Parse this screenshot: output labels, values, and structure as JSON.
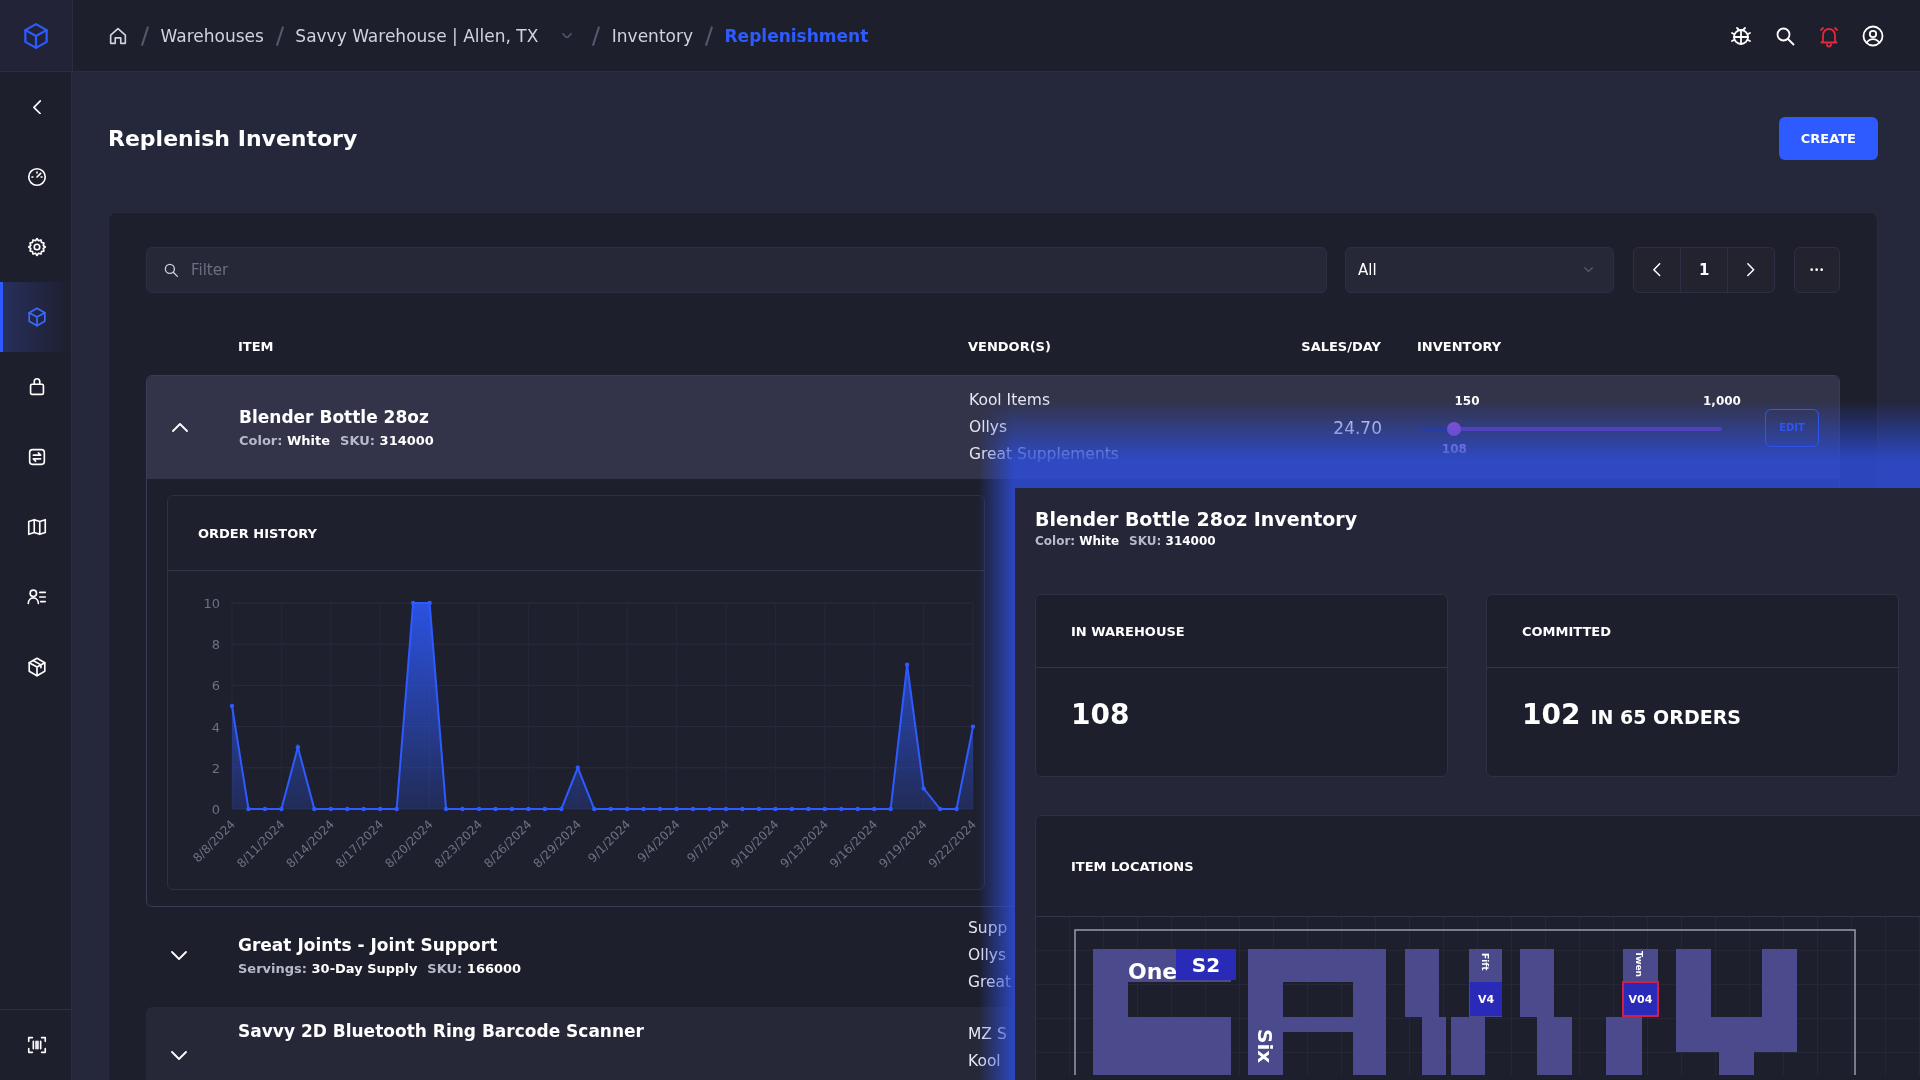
{
  "topbar": {
    "breadcrumbs": [
      {
        "label": "Warehouses",
        "kind": "link"
      },
      {
        "label": "Savvy Warehouse | Allen, TX",
        "kind": "dropdown"
      },
      {
        "label": "Inventory",
        "kind": "link"
      },
      {
        "label": "Replenishment",
        "kind": "current"
      }
    ],
    "alert": true
  },
  "sidebar": {
    "items": [
      {
        "kind": "gauge",
        "selected": false
      },
      {
        "kind": "gear",
        "selected": false
      },
      {
        "kind": "cube",
        "selected": true
      },
      {
        "kind": "bag",
        "selected": false
      },
      {
        "kind": "swap",
        "selected": false
      },
      {
        "kind": "map",
        "selected": false
      },
      {
        "kind": "user-list",
        "selected": false
      },
      {
        "kind": "package",
        "selected": false
      }
    ],
    "footer": [
      {
        "kind": "barcode",
        "selected": false
      }
    ]
  },
  "page": {
    "title": "Replenish Inventory",
    "create_button": "CREATE"
  },
  "toolbar": {
    "filter": {
      "placeholder": "Filter"
    },
    "select": {
      "value": "All"
    },
    "pager": {
      "page": "1"
    }
  },
  "table": {
    "columns": [
      "ITEM",
      "VENDOR(S)",
      "SALES/DAY",
      "INVENTORY"
    ],
    "rows": [
      {
        "name": "Blender Bottle 28oz",
        "meta": [
          "Color: **White**",
          "SKU: **314000**"
        ],
        "vendors": [
          "Kool Items",
          "Ollys",
          "Great Supplements"
        ],
        "sales_per_day": "24.70",
        "inventory": {
          "level": 0.108,
          "reading": "108",
          "markers": [
            "150",
            "1,000"
          ]
        },
        "edit": "EDIT",
        "expanded": true,
        "order_history": {
          "chart_data": {
            "type": "area",
            "title": "ORDER HISTORY",
            "categories": [
              "8/8/2024",
              null,
              null,
              "8/11/2024",
              null,
              null,
              "8/14/2024",
              null,
              null,
              "8/17/2024",
              null,
              null,
              "8/20/2024",
              null,
              null,
              "8/23/2024",
              null,
              null,
              "8/26/2024",
              null,
              null,
              "8/29/2024",
              null,
              null,
              "9/1/2024",
              null,
              null,
              "9/4/2024",
              null,
              null,
              "9/7/2024",
              null,
              null,
              "9/10/2024",
              null,
              null,
              "9/13/2024",
              null,
              null,
              "9/16/2024",
              null,
              null,
              "9/19/2024",
              null,
              null,
              "9/22/2024"
            ],
            "grid": true,
            "series": [
              {
                "color": "#2d5bff",
                "values": [
                  5,
                  0,
                  0,
                  0,
                  3,
                  0,
                  0,
                  0,
                  0,
                  0,
                  0,
                  10,
                  10,
                  0,
                  0,
                  0,
                  0,
                  0,
                  0,
                  0,
                  0,
                  2,
                  0,
                  0,
                  0,
                  0,
                  0,
                  0,
                  0,
                  0,
                  0,
                  0,
                  0,
                  0,
                  0,
                  0,
                  0,
                  0,
                  0,
                  0,
                  0,
                  7,
                  1,
                  0,
                  0,
                  4
                ]
              }
            ],
            "ylim": [
              0,
              10
            ],
            "yticks": [
              0,
              2,
              4,
              6,
              8,
              10
            ]
          }
        }
      },
      {
        "name": "Great Joints - Joint Support",
        "meta": [
          "Servings: **30-Day Supply**",
          "SKU: **166000**"
        ],
        "vendors": [
          "Supp",
          "Ollys",
          "Great"
        ],
        "expanded": false
      },
      {
        "name": "Savvy 2D Bluetooth Ring Barcode Scanner",
        "vendors": [
          "MZ S",
          "Kool"
        ],
        "expanded": false
      }
    ]
  },
  "drawer": {
    "title": "Blender Bottle 28oz Inventory",
    "meta": [
      "Color: **White**",
      "SKU: **314000**"
    ],
    "stats": [
      {
        "label": "IN WAREHOUSE",
        "value": "108"
      },
      {
        "label": "COMMITTED",
        "value": "102",
        "caption": "IN 65 ORDERS"
      }
    ],
    "locations": {
      "title": "ITEM LOCATIONS",
      "labels": [
        {
          "text": "One",
          "kind": "zone"
        },
        {
          "text": "S2",
          "kind": "bin",
          "highlighted": false
        },
        {
          "text": "Six",
          "kind": "zone"
        },
        {
          "text": "Fift",
          "kind": "zone"
        },
        {
          "text": "V4",
          "kind": "bin",
          "highlighted": false
        },
        {
          "text": "Twen",
          "kind": "zone"
        },
        {
          "text": "V04",
          "kind": "bin",
          "highlighted": true
        }
      ]
    }
  }
}
